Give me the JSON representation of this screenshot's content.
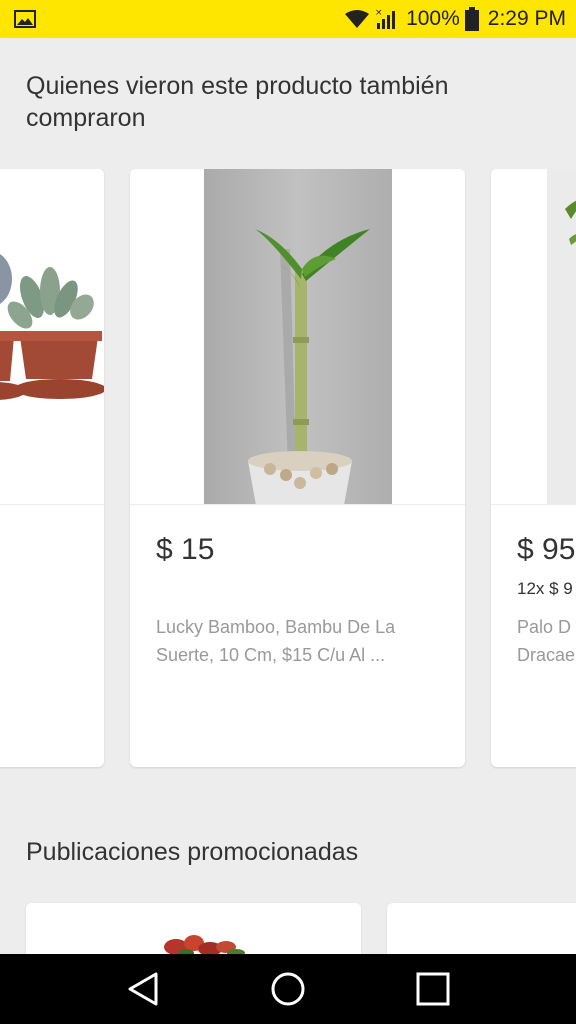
{
  "status_bar": {
    "battery_percent": "100%",
    "time": "2:29 PM",
    "icons": [
      "image-notification-icon",
      "wifi-icon",
      "signal-icon",
      "battery-icon"
    ]
  },
  "related": {
    "title": "Quienes vieron este producto también compraron",
    "items": [
      {
        "price": "",
        "installments": "",
        "title": ""
      },
      {
        "price": "$ 15",
        "installments": "",
        "title": "Lucky Bamboo, Bambu De La Suerte, 10 Cm, $15 C/u Al ..."
      },
      {
        "price": "$ 95",
        "installments": "12x $ 9",
        "title": "Palo D Dracae"
      }
    ]
  },
  "promoted": {
    "title": "Publicaciones promocionadas"
  },
  "nav": {
    "icons": [
      "back-icon",
      "home-icon",
      "recents-icon"
    ]
  },
  "colors": {
    "status_bar_bg": "#ffe600",
    "page_bg": "#ededed",
    "card_bg": "#ffffff",
    "text_primary": "#333333",
    "text_secondary": "#999999"
  }
}
